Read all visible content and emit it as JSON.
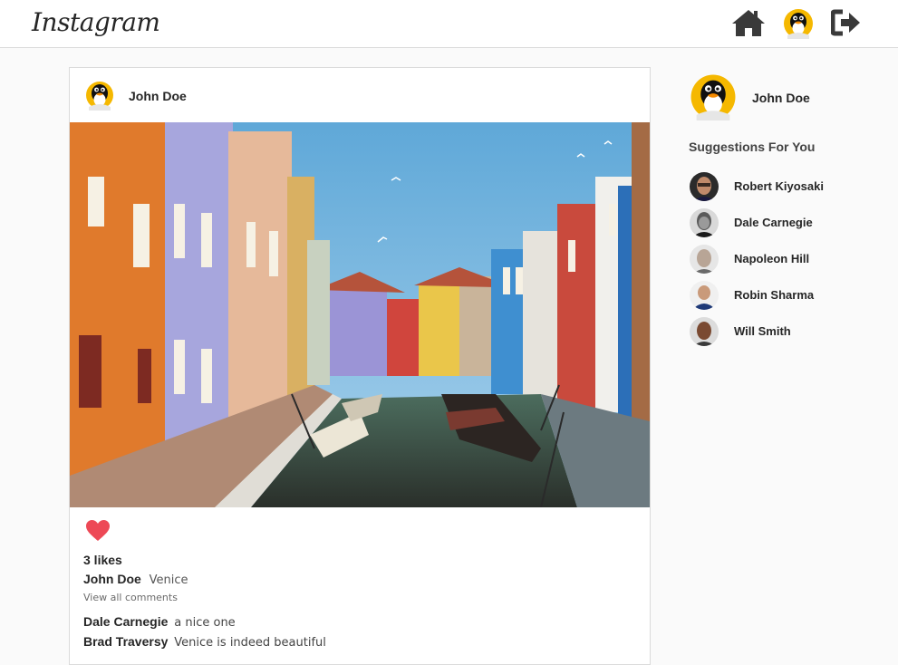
{
  "app": {
    "logo": "Instagram"
  },
  "nav": {
    "icons": [
      "home-icon",
      "profile-avatar",
      "logout-icon"
    ]
  },
  "post": {
    "username": "John Doe",
    "likes_text": "3 likes",
    "caption": {
      "user": "John Doe",
      "text": "Venice"
    },
    "view_all_comments": "View all comments",
    "comments": [
      {
        "user": "Dale Carnegie",
        "text": "a nice one"
      },
      {
        "user": "Brad Traversy",
        "text": "Venice is indeed beautiful"
      }
    ],
    "like_color": "#ed4956"
  },
  "sidebar": {
    "username": "John Doe",
    "suggestions_title": "Suggestions For You",
    "suggestions": [
      {
        "name": "Robert Kiyosaki"
      },
      {
        "name": "Dale Carnegie"
      },
      {
        "name": "Napoleon Hill"
      },
      {
        "name": "Robin Sharma"
      },
      {
        "name": "Will Smith"
      }
    ]
  },
  "colors": {
    "background": "#fafafa",
    "border": "#dbdbdb",
    "text": "#262626"
  }
}
